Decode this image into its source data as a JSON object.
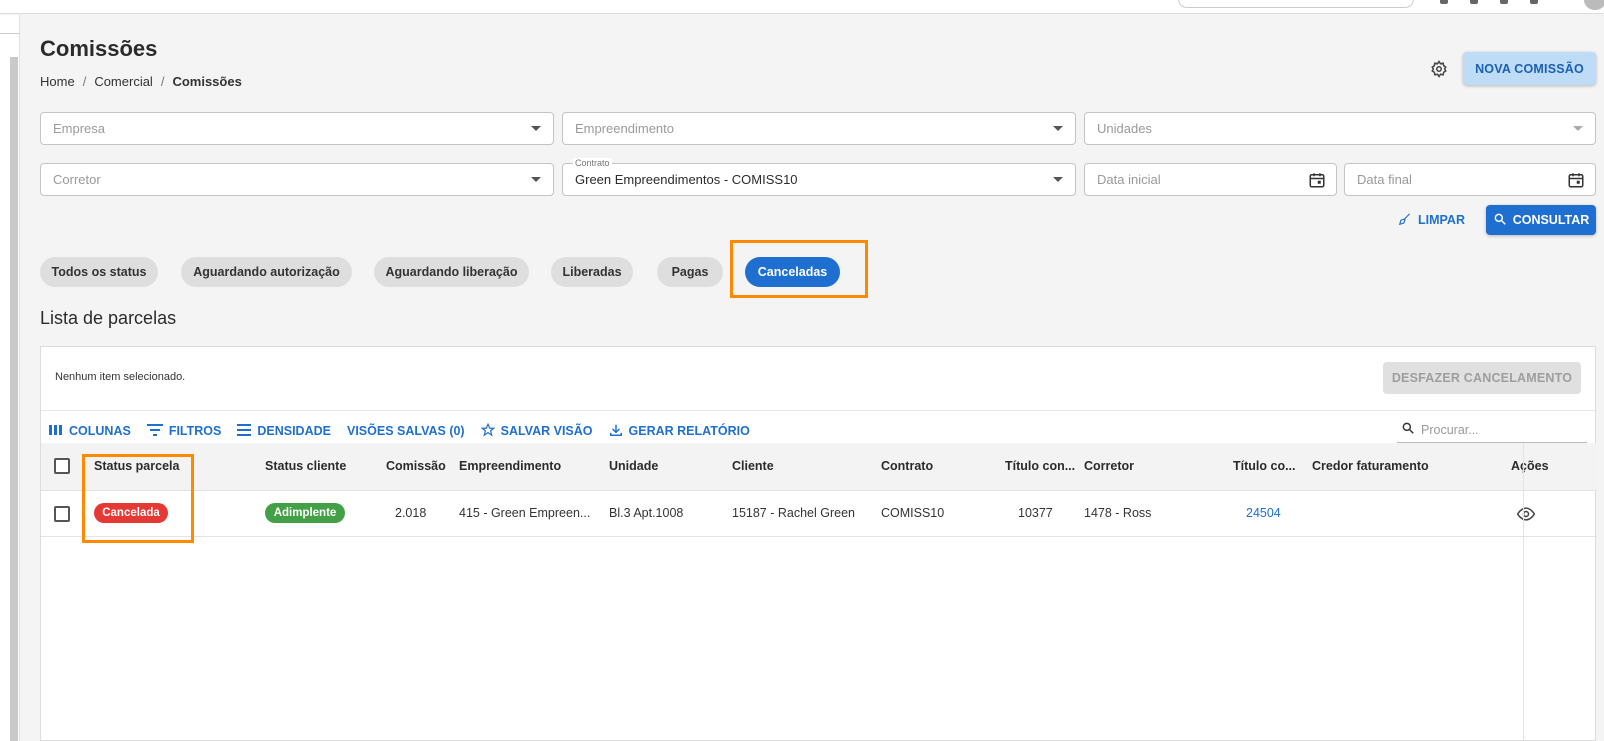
{
  "colors": {
    "accent": "#1e6fd0",
    "accent_light": "#bfdcf7",
    "highlight": "#ff8a00",
    "badge_cancelada": "#e53935",
    "badge_adimplente": "#43a047"
  },
  "page": {
    "title": "Comissões",
    "breadcrumb": [
      "Home",
      "/",
      "Comercial",
      "/",
      "Comissões"
    ]
  },
  "header_actions": {
    "settings_icon": "gear-icon",
    "nova_label": "NOVA COMISSÃO"
  },
  "filters": {
    "empresa_placeholder": "Empresa",
    "empreendimento_placeholder": "Empreendimento",
    "unidades_placeholder": "Unidades",
    "corretor_placeholder": "Corretor",
    "contrato_label": "Contrato",
    "contrato_value": "Green Empreendimentos - COMISS10",
    "data_inicial_placeholder": "Data inicial",
    "data_final_placeholder": "Data final",
    "limpar_label": "LIMPAR",
    "consultar_label": "CONSULTAR"
  },
  "status_chips": [
    {
      "label": "Todos os status",
      "active": false
    },
    {
      "label": "Aguardando autorização",
      "active": false
    },
    {
      "label": "Aguardando liberação",
      "active": false
    },
    {
      "label": "Liberadas",
      "active": false
    },
    {
      "label": "Pagas",
      "active": false
    },
    {
      "label": "Canceladas",
      "active": true
    }
  ],
  "list": {
    "title": "Lista de parcelas",
    "selection_info": "Nenhum item selecionado.",
    "desfazer_label": "DESFAZER CANCELAMENTO",
    "toolbar": {
      "colunas": "COLUNAS",
      "filtros": "FILTROS",
      "densidade": "DENSIDADE",
      "visoes": "VISÕES SALVAS (0)",
      "salvar": "SALVAR VISÃO",
      "gerar": "GERAR RELATÓRIO",
      "search_placeholder": "Procurar..."
    },
    "columns": [
      "Status parcela",
      "Status cliente",
      "Comissão",
      "Empreendimento",
      "Unidade",
      "Cliente",
      "Contrato",
      "Título con...",
      "Corretor",
      "Título co...",
      "Credor faturamento",
      "Ações"
    ],
    "rows": [
      {
        "status_parcela": "Cancelada",
        "status_cliente": "Adimplente",
        "comissao": "2.018",
        "empreendimento": "415 - Green Empreen...",
        "unidade": "Bl.3 Apt.1008",
        "cliente": "15187 - Rachel Green",
        "contrato": "COMISS10",
        "titulo_con": "10377",
        "corretor": "1478 - Ross",
        "titulo_co": "24504",
        "credor": "",
        "acoes_icon": "eye-icon"
      }
    ]
  }
}
